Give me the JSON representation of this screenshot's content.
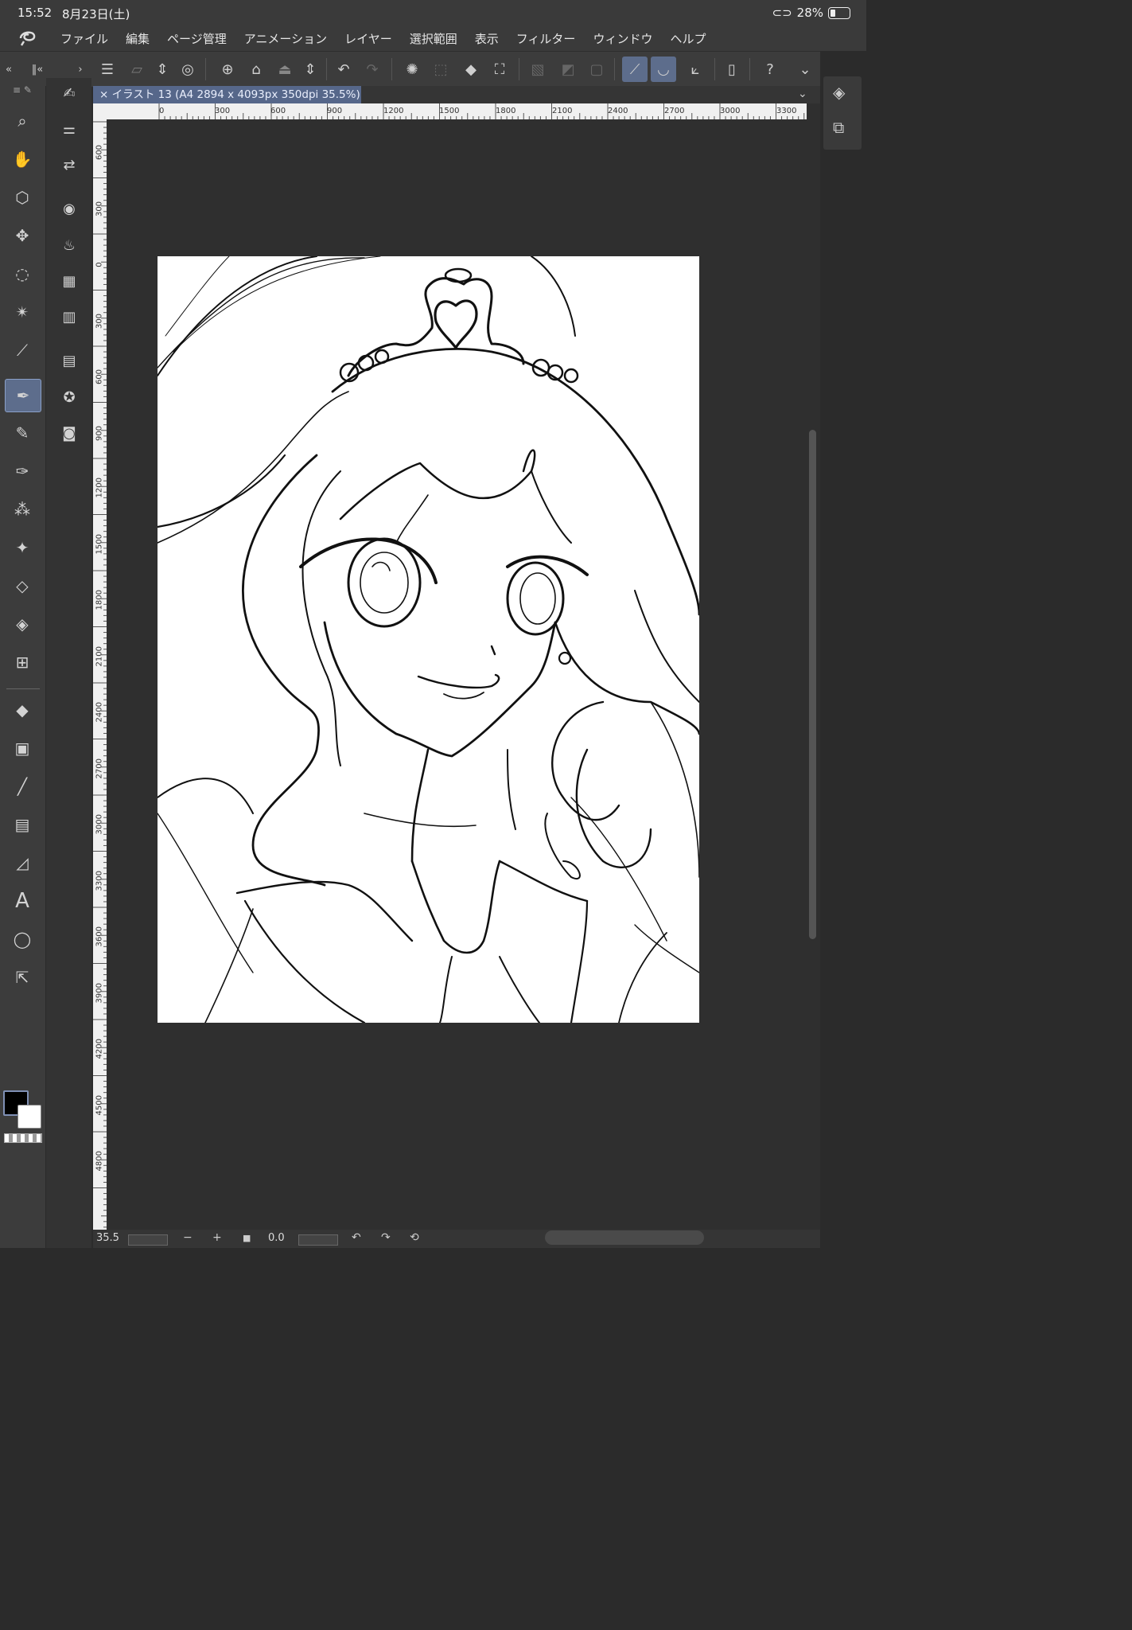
{
  "status_bar": {
    "time": "15:52",
    "date": "8月23日(土)",
    "battery": "28%"
  },
  "menu": {
    "items": [
      "ファイル",
      "編集",
      "ページ管理",
      "アニメーション",
      "レイヤー",
      "選択範囲",
      "表示",
      "フィルター",
      "ウィンドウ",
      "ヘルプ"
    ]
  },
  "document": {
    "tab_label": "イラスト 13 (A4 2894 x 4093px 350dpi 35.5%)",
    "close_glyph": "×"
  },
  "ruler": {
    "horizontal_ticks": [
      "0",
      "300",
      "600",
      "900",
      "1200",
      "1500",
      "1800",
      "2100",
      "2400",
      "2700",
      "3000",
      "3300"
    ],
    "vertical_ticks": [
      "600",
      "300",
      "0",
      "300",
      "600",
      "900",
      "1200",
      "1500",
      "1800",
      "2100",
      "2400",
      "2700",
      "3000",
      "3300",
      "3600",
      "3900",
      "4200",
      "4500",
      "4800"
    ]
  },
  "bottom": {
    "zoom": "35.5",
    "rotation": "0.0"
  },
  "colors": {
    "accent": "#5d6d8c",
    "main_color": "#000000",
    "sub_color": "#ffffff"
  },
  "tools": {
    "main": [
      "zoom",
      "hand",
      "3d-object",
      "move",
      "lasso",
      "auto-select",
      "eyedropper",
      "pen",
      "pencil",
      "brush",
      "airbrush",
      "decoration",
      "eraser",
      "blend",
      "mesh",
      "fill",
      "gradient",
      "figure",
      "frame",
      "ruler",
      "text",
      "balloon",
      "operation"
    ],
    "active": "pen"
  }
}
